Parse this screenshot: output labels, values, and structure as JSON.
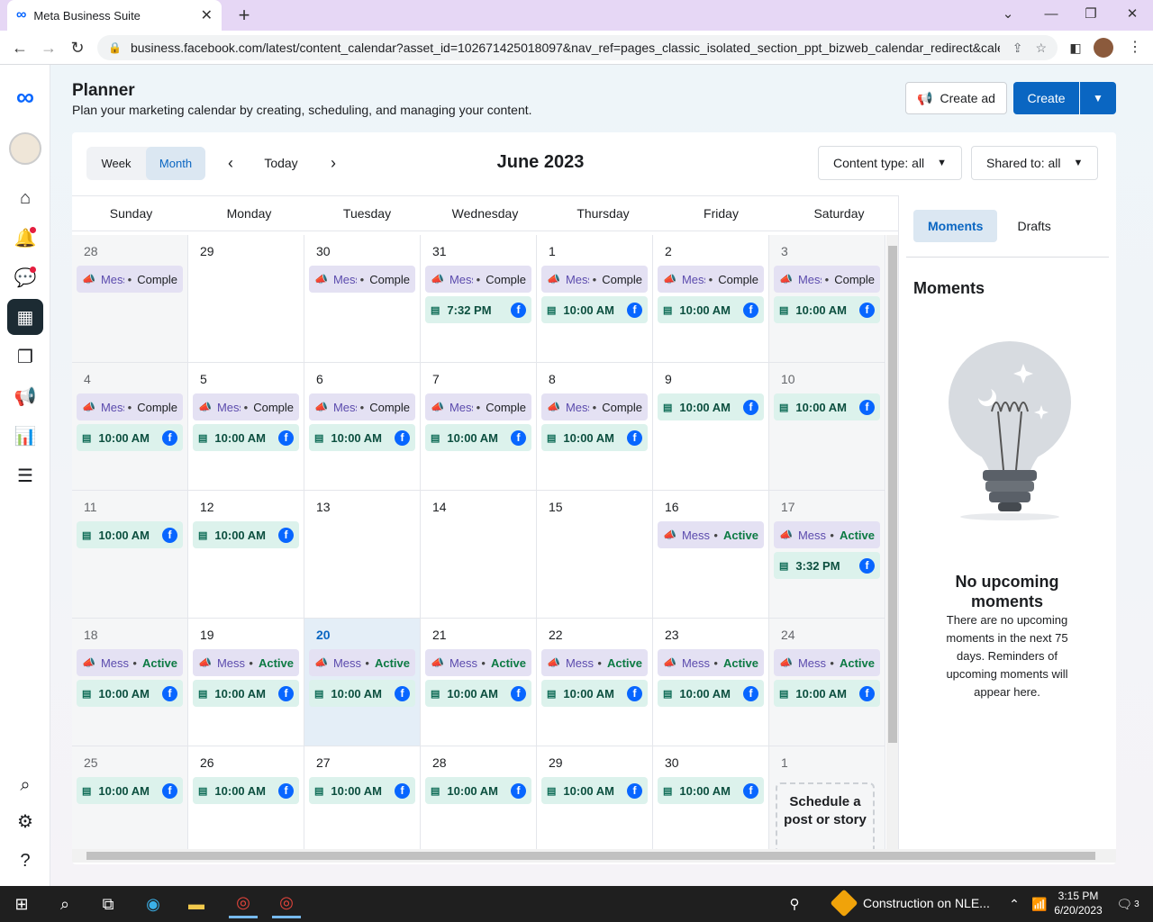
{
  "browser": {
    "tab_title": "Meta Business Suite",
    "url": "business.facebook.com/latest/content_calendar?asset_id=102671425018097&nav_ref=pages_classic_isolated_section_ppt_bizweb_calendar_redirect&cale..."
  },
  "header": {
    "title": "Planner",
    "subtitle": "Plan your marketing calendar by creating, scheduling, and managing your content.",
    "create_ad": "Create ad",
    "create": "Create"
  },
  "toolbar": {
    "week": "Week",
    "month": "Month",
    "today": "Today",
    "month_title": "June 2023",
    "content_type": "Content type: all",
    "shared_to": "Shared to: all"
  },
  "days_of_week": [
    "Sunday",
    "Monday",
    "Tuesday",
    "Wednesday",
    "Thursday",
    "Friday",
    "Saturday"
  ],
  "ad_label": "Mess",
  "status": {
    "complete": "Comple",
    "active": "Active"
  },
  "schedule_prompt": "Schedule a post or story",
  "weeks": [
    [
      {
        "date": "28",
        "other": true,
        "items": [
          {
            "t": "ad",
            "s": "complete"
          }
        ]
      },
      {
        "date": "29",
        "other": false,
        "items": []
      },
      {
        "date": "30",
        "other": false,
        "items": [
          {
            "t": "ad",
            "s": "complete"
          }
        ]
      },
      {
        "date": "31",
        "other": false,
        "items": [
          {
            "t": "ad",
            "s": "complete"
          },
          {
            "t": "post",
            "time": "7:32 PM"
          }
        ]
      },
      {
        "date": "1",
        "other": false,
        "items": [
          {
            "t": "ad",
            "s": "complete"
          },
          {
            "t": "post",
            "time": "10:00 AM"
          }
        ]
      },
      {
        "date": "2",
        "other": false,
        "items": [
          {
            "t": "ad",
            "s": "complete"
          },
          {
            "t": "post",
            "time": "10:00 AM"
          }
        ]
      },
      {
        "date": "3",
        "other": true,
        "items": [
          {
            "t": "ad",
            "s": "complete"
          },
          {
            "t": "post",
            "time": "10:00 AM"
          }
        ]
      }
    ],
    [
      {
        "date": "4",
        "other": true,
        "items": [
          {
            "t": "ad",
            "s": "complete"
          },
          {
            "t": "post",
            "time": "10:00 AM"
          }
        ]
      },
      {
        "date": "5",
        "other": false,
        "items": [
          {
            "t": "ad",
            "s": "complete"
          },
          {
            "t": "post",
            "time": "10:00 AM"
          }
        ]
      },
      {
        "date": "6",
        "other": false,
        "items": [
          {
            "t": "ad",
            "s": "complete"
          },
          {
            "t": "post",
            "time": "10:00 AM"
          }
        ]
      },
      {
        "date": "7",
        "other": false,
        "items": [
          {
            "t": "ad",
            "s": "complete"
          },
          {
            "t": "post",
            "time": "10:00 AM"
          }
        ]
      },
      {
        "date": "8",
        "other": false,
        "items": [
          {
            "t": "ad",
            "s": "complete"
          },
          {
            "t": "post",
            "time": "10:00 AM"
          }
        ]
      },
      {
        "date": "9",
        "other": false,
        "items": [
          {
            "t": "post",
            "time": "10:00 AM"
          }
        ]
      },
      {
        "date": "10",
        "other": true,
        "items": [
          {
            "t": "post",
            "time": "10:00 AM"
          }
        ]
      }
    ],
    [
      {
        "date": "11",
        "other": true,
        "items": [
          {
            "t": "post",
            "time": "10:00 AM"
          }
        ]
      },
      {
        "date": "12",
        "other": false,
        "items": [
          {
            "t": "post",
            "time": "10:00 AM"
          }
        ]
      },
      {
        "date": "13",
        "other": false,
        "items": []
      },
      {
        "date": "14",
        "other": false,
        "items": []
      },
      {
        "date": "15",
        "other": false,
        "items": []
      },
      {
        "date": "16",
        "other": false,
        "items": [
          {
            "t": "ad",
            "s": "active"
          }
        ]
      },
      {
        "date": "17",
        "other": true,
        "items": [
          {
            "t": "ad",
            "s": "active"
          },
          {
            "t": "post",
            "time": "3:32 PM"
          }
        ]
      }
    ],
    [
      {
        "date": "18",
        "other": true,
        "items": [
          {
            "t": "ad",
            "s": "active"
          },
          {
            "t": "post",
            "time": "10:00 AM"
          }
        ]
      },
      {
        "date": "19",
        "other": false,
        "items": [
          {
            "t": "ad",
            "s": "active"
          },
          {
            "t": "post",
            "time": "10:00 AM"
          }
        ]
      },
      {
        "date": "20",
        "other": false,
        "today": true,
        "items": [
          {
            "t": "ad",
            "s": "active"
          },
          {
            "t": "post",
            "time": "10:00 AM"
          }
        ]
      },
      {
        "date": "21",
        "other": false,
        "items": [
          {
            "t": "ad",
            "s": "active"
          },
          {
            "t": "post",
            "time": "10:00 AM"
          }
        ]
      },
      {
        "date": "22",
        "other": false,
        "items": [
          {
            "t": "ad",
            "s": "active"
          },
          {
            "t": "post",
            "time": "10:00 AM"
          }
        ]
      },
      {
        "date": "23",
        "other": false,
        "items": [
          {
            "t": "ad",
            "s": "active"
          },
          {
            "t": "post",
            "time": "10:00 AM"
          }
        ]
      },
      {
        "date": "24",
        "other": true,
        "items": [
          {
            "t": "ad",
            "s": "active"
          },
          {
            "t": "post",
            "time": "10:00 AM"
          }
        ]
      }
    ],
    [
      {
        "date": "25",
        "other": true,
        "items": [
          {
            "t": "post",
            "time": "10:00 AM"
          }
        ]
      },
      {
        "date": "26",
        "other": false,
        "items": [
          {
            "t": "post",
            "time": "10:00 AM"
          }
        ]
      },
      {
        "date": "27",
        "other": false,
        "items": [
          {
            "t": "post",
            "time": "10:00 AM"
          }
        ]
      },
      {
        "date": "28",
        "other": false,
        "items": [
          {
            "t": "post",
            "time": "10:00 AM"
          }
        ]
      },
      {
        "date": "29",
        "other": false,
        "items": [
          {
            "t": "post",
            "time": "10:00 AM"
          }
        ]
      },
      {
        "date": "30",
        "other": false,
        "items": [
          {
            "t": "post",
            "time": "10:00 AM"
          }
        ]
      },
      {
        "date": "1",
        "other": true,
        "schedule": true,
        "items": []
      }
    ]
  ],
  "sidebar": {
    "tab_moments": "Moments",
    "tab_drafts": "Drafts",
    "heading": "Moments",
    "empty_title": "No upcoming moments",
    "empty_text": "There are no upcoming moments in the next 75 days. Reminders of upcoming moments will appear here."
  },
  "taskbar": {
    "notice": "Construction on NLE...",
    "time": "3:15 PM",
    "date": "6/20/2023",
    "notif_count": "3"
  },
  "colors": {
    "brand": "#0866ff",
    "primary_button": "#0a66c2",
    "ad_chip": "#e4e1f3",
    "post_chip": "#dcf2ec",
    "today_bg": "#e4eef7"
  }
}
